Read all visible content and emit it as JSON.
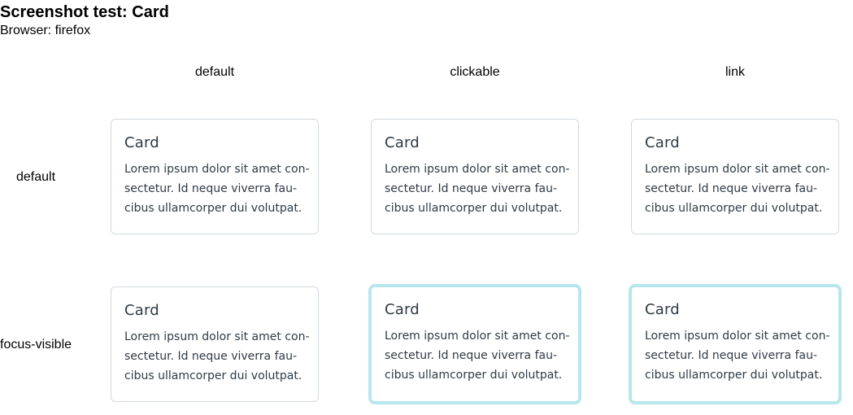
{
  "page": {
    "title": "Screenshot test: Card",
    "browser": "Browser: firefox"
  },
  "columns": [
    "default",
    "clickable",
    "link"
  ],
  "rows": [
    "default",
    "focus-visible"
  ],
  "card": {
    "title": "Card",
    "body_lines": [
      "Lorem ipsum dolor sit amet con-",
      "sectetur. Id neque viverra fau-",
      "cibus ullamcorper dui volutpat."
    ]
  },
  "colors": {
    "card_border": "#d3d9e0",
    "focus_ring": "#b7e6ec",
    "card_text": "#2f3a45"
  }
}
